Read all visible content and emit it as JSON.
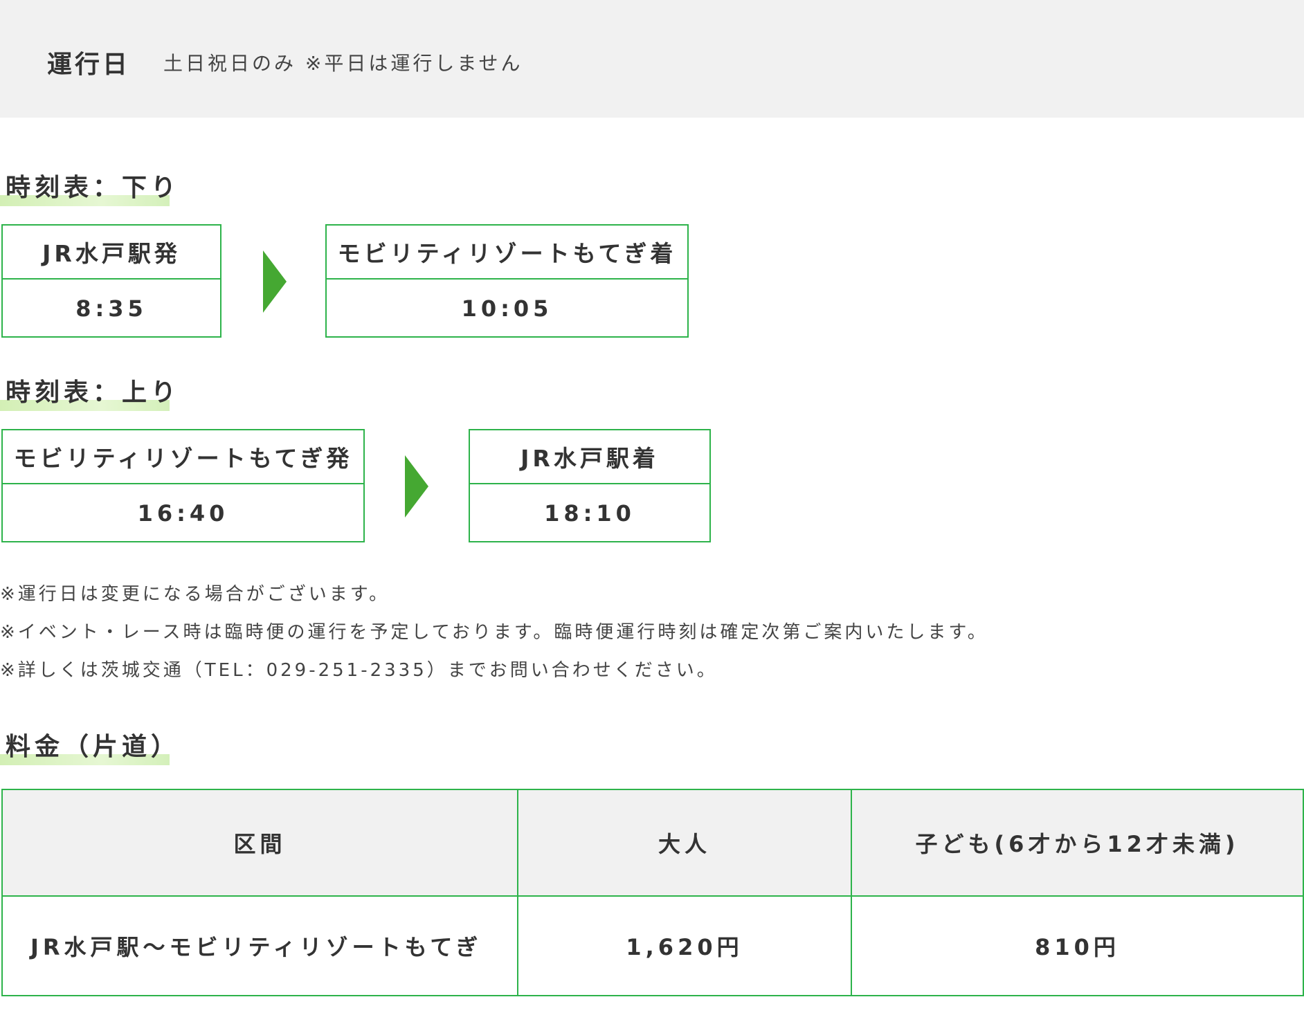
{
  "operation": {
    "label": "運行日",
    "value": "土日祝日のみ ※平日は運行しません"
  },
  "timetable_down": {
    "heading": "時刻表：下り",
    "from": {
      "station": "JR水戸駅発",
      "time": "8:35"
    },
    "to": {
      "station": "モビリティリゾートもてぎ着",
      "time": "10:05"
    }
  },
  "timetable_up": {
    "heading": "時刻表：上り",
    "from": {
      "station": "モビリティリゾートもてぎ発",
      "time": "16:40"
    },
    "to": {
      "station": "JR水戸駅着",
      "time": "18:10"
    }
  },
  "notes": [
    "※運行日は変更になる場合がございます。",
    "※イベント・レース時は臨時便の運行を予定しております。臨時便運行時刻は確定次第ご案内いたします。",
    "※詳しくは茨城交通（TEL：029-251-2335）までお問い合わせください。"
  ],
  "fare": {
    "heading": "料金（片道）",
    "headers": [
      "区間",
      "大人",
      "子ども(6才から12才未満)"
    ],
    "rows": [
      [
        "JR水戸駅～モビリティリゾートもてぎ",
        "1,620円",
        "810円"
      ]
    ]
  },
  "colors": {
    "accent_green": "#2db34a",
    "arrow_green": "#45a832",
    "highlight_green": "#d3efb5",
    "banner_gray": "#f1f1f1"
  }
}
